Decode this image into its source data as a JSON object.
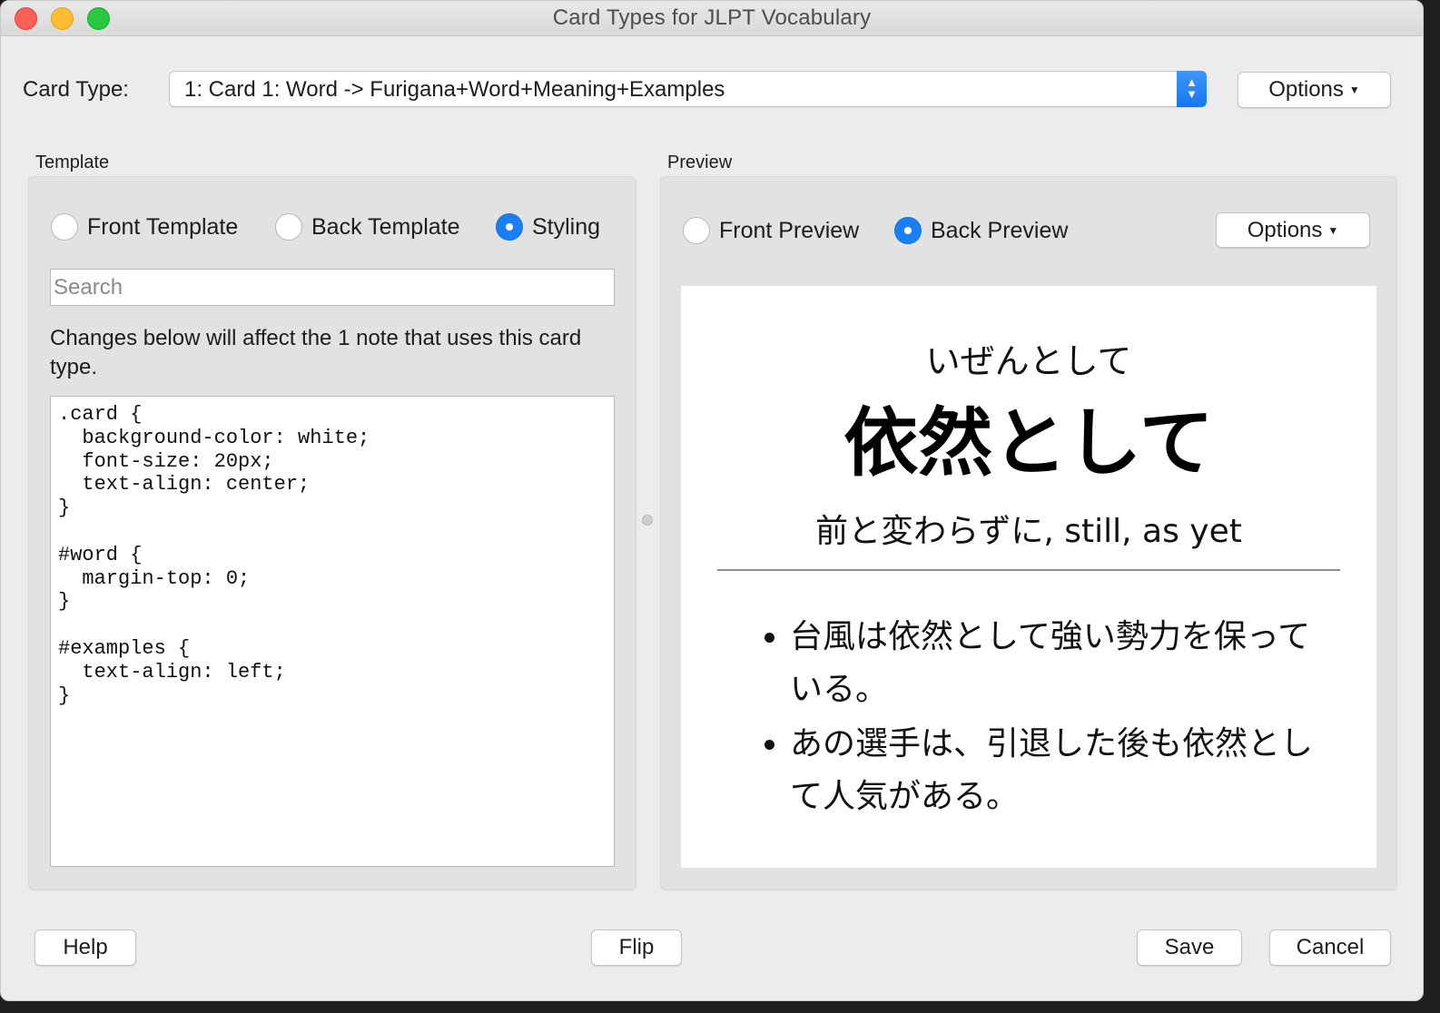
{
  "window": {
    "title": "Card Types for JLPT Vocabulary",
    "traffic_lights": [
      "close",
      "minimize",
      "maximize"
    ]
  },
  "card_type": {
    "label": "Card Type:",
    "selected": "1: Card 1: Word -> Furigana+Word+Meaning+Examples",
    "stepper": "⌃⌄",
    "options_label": "Options"
  },
  "template": {
    "section_label": "Template",
    "radios": [
      {
        "label": "Front Template",
        "selected": false
      },
      {
        "label": "Back Template",
        "selected": false
      },
      {
        "label": "Styling",
        "selected": true
      }
    ],
    "search_placeholder": "Search",
    "notice": "Changes below will affect the 1 note that uses this card type.",
    "code": ".card {\n  background-color: white;\n  font-size: 20px;\n  text-align: center;\n}\n\n#word {\n  margin-top: 0;\n}\n\n#examples {\n  text-align: left;\n}"
  },
  "preview": {
    "section_label": "Preview",
    "radios": [
      {
        "label": "Front Preview",
        "selected": false
      },
      {
        "label": "Back Preview",
        "selected": true
      }
    ],
    "options_label": "Options",
    "card": {
      "furigana": "いぜんとして",
      "word": "依然として",
      "meaning": "前と変わらずに, still, as yet",
      "examples": [
        "台風は依然として強い勢力を保っている。",
        "あの選手は、引退した後も依然として人気がある。"
      ]
    }
  },
  "footer": {
    "help": "Help",
    "flip": "Flip",
    "save": "Save",
    "cancel": "Cancel"
  },
  "colors": {
    "accent": "#1a7ff5",
    "window_bg": "#ececec",
    "panel_bg": "#e2e2e2",
    "close": "#fe5f57",
    "minimize": "#febc2e",
    "maximize": "#28c840"
  }
}
